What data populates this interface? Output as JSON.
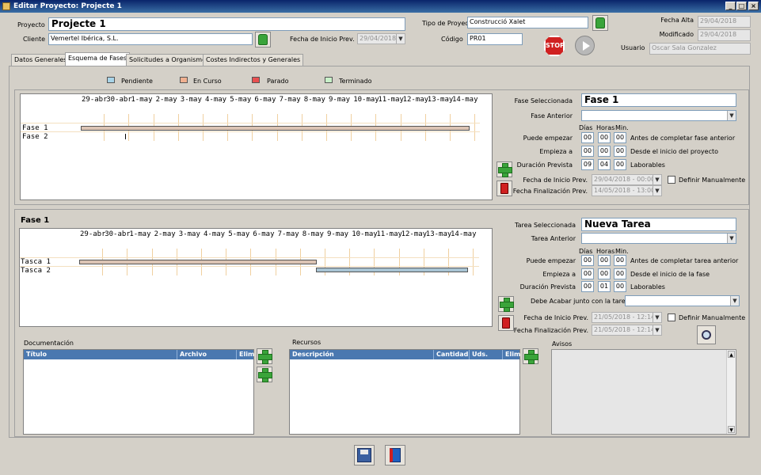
{
  "window": {
    "title": "Editar Proyecto: Projecte 1",
    "btn_min": "_",
    "btn_max": "□",
    "btn_close": "×"
  },
  "header": {
    "proyecto_label": "Proyecto",
    "proyecto_value": "Projecte 1",
    "cliente_label": "Cliente",
    "cliente_value": "Vemertel Ibérica, S.L.",
    "tipo_label": "Tipo de Proyect",
    "tipo_value": "Construcció Xalet",
    "fecha_inicio_label": "Fecha de Inicio Prev.",
    "fecha_inicio_value": "29/04/2018",
    "codigo_label": "Código",
    "codigo_value": "PR01",
    "fecha_alta_label": "Fecha Alta",
    "fecha_alta_value": "29/04/2018",
    "modificado_label": "Modificado",
    "modificado_value": "29/04/2018",
    "usuario_label": "Usuario",
    "usuario_value": "Oscar Sala Gonzalez",
    "stop_label": "STOP"
  },
  "tabs": [
    {
      "label": "Datos Generales"
    },
    {
      "label": "Esquema de Fases"
    },
    {
      "label": "Solicitudes a Organismos"
    },
    {
      "label": "Costes Indirectos y Generales"
    }
  ],
  "legend": [
    {
      "label": "Pendiente",
      "color": "#a8d4e8"
    },
    {
      "label": "En Curso",
      "color": "#f0b090"
    },
    {
      "label": "Parado",
      "color": "#e85050"
    },
    {
      "label": "Terminado",
      "color": "#c8f0c8"
    }
  ],
  "dates": [
    "29-abr",
    "30-abr",
    "1-may",
    "2-may",
    "3-may",
    "4-may",
    "5-may",
    "6-may",
    "7-may",
    "8-may",
    "9-may",
    "10-may",
    "11-may",
    "12-may",
    "13-may",
    "14-may"
  ],
  "fases": {
    "rows": [
      {
        "label": "Fase 1"
      },
      {
        "label": "Fase 2"
      }
    ],
    "form": {
      "fase_sel_label": "Fase Seleccionada",
      "fase_sel_value": "Fase 1",
      "anterior_label": "Fase Anterior",
      "anterior_value": "",
      "dias_label": "Días",
      "horas_label": "Horas",
      "min_label": "Min.",
      "puede_label": "Puede empezar",
      "puede_d": "00",
      "puede_h": "00",
      "puede_m": "00",
      "puede_desc": "Antes de completar fase anterior",
      "empieza_label": "Empieza a",
      "empieza_d": "00",
      "empieza_h": "00",
      "empieza_m": "00",
      "empieza_desc": "Desde el inicio del proyecto",
      "duracion_label": "Duración Prevista",
      "duracion_d": "09",
      "duracion_h": "04",
      "duracion_m": "00",
      "duracion_desc": "Laborables",
      "fi_label": "Fecha de Inicio Prev.",
      "fi_value": "29/04/2018 - 00:00",
      "ff_label": "Fecha Finalización Prev.",
      "ff_value": "14/05/2018 - 13:00",
      "manual_label": "Definir Manualmente"
    }
  },
  "tareas": {
    "title": "Fase 1",
    "rows": [
      {
        "label": "Tasca 1"
      },
      {
        "label": "Tasca 2"
      }
    ],
    "form": {
      "tarea_sel_label": "Tarea Seleccionada",
      "tarea_sel_value": "Nueva Tarea",
      "anterior_label": "Tarea Anterior",
      "anterior_value": "",
      "dias_label": "Días",
      "horas_label": "Horas",
      "min_label": "Min.",
      "puede_label": "Puede empezar",
      "puede_d": "00",
      "puede_h": "00",
      "puede_m": "00",
      "puede_desc": "Antes de completar tarea anterior",
      "empieza_label": "Empieza a",
      "empieza_d": "00",
      "empieza_h": "00",
      "empieza_m": "00",
      "empieza_desc": "Desde el inicio de la fase",
      "duracion_label": "Duración Prevista",
      "duracion_d": "00",
      "duracion_h": "01",
      "duracion_m": "00",
      "duracion_desc": "Laborables",
      "acabar_label": "Debe Acabar junto con la tarea",
      "acabar_value": "",
      "fi_label": "Fecha de Inicio Prev.",
      "fi_value": "21/05/2018 - 12:14",
      "ff_label": "Fecha Finalización Prev.",
      "ff_value": "21/05/2018 - 12:14",
      "manual_label": "Definir Manualmente"
    }
  },
  "documentacion": {
    "title": "Documentación",
    "cols": [
      "Título",
      "Archivo",
      "Elim"
    ]
  },
  "recursos": {
    "title": "Recursos",
    "cols": [
      "Descripción",
      "Cantidad",
      "Uds.",
      "Elim"
    ]
  },
  "avisos": {
    "title": "Avisos"
  }
}
